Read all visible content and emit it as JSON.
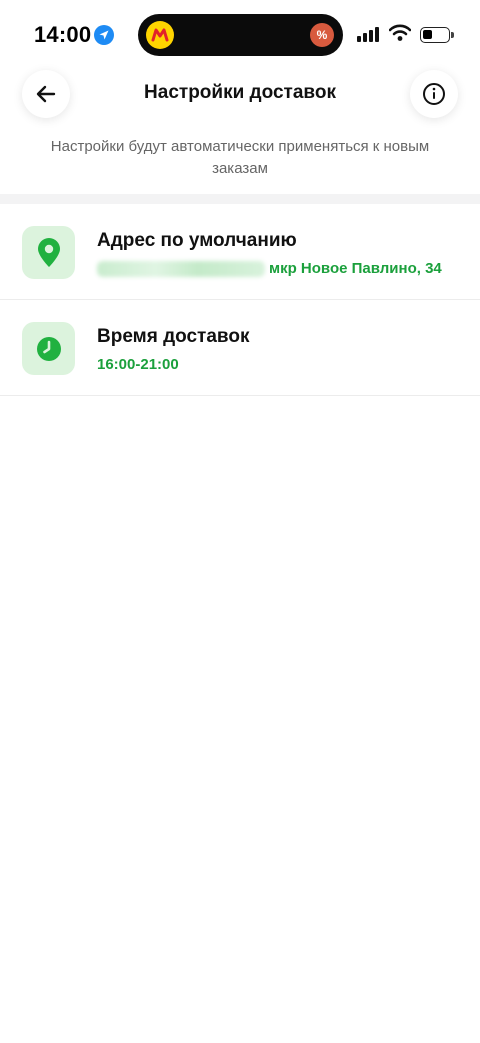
{
  "status_bar": {
    "time": "14:00",
    "icons": [
      "location-arrow-icon",
      "yandex-market-logo",
      "discount-percent-icon",
      "cellular-signal-icon",
      "wifi-icon",
      "battery-icon"
    ]
  },
  "header": {
    "title": "Настройки доставок",
    "back_icon": "arrow-left-icon",
    "info_icon": "info-icon"
  },
  "subtitle": "Настройки будут автоматически применяться к новым заказам",
  "settings": [
    {
      "icon": "map-pin-icon",
      "title": "Адрес по умолчанию",
      "value": "мкр Новое Павлино, 34"
    },
    {
      "icon": "clock-icon",
      "title": "Время доставок",
      "value": "16:00-21:00"
    }
  ],
  "colors": {
    "accent_green": "#1ba03c",
    "icon_bg": "#dcf3dd",
    "icon_fg": "#21b140"
  }
}
